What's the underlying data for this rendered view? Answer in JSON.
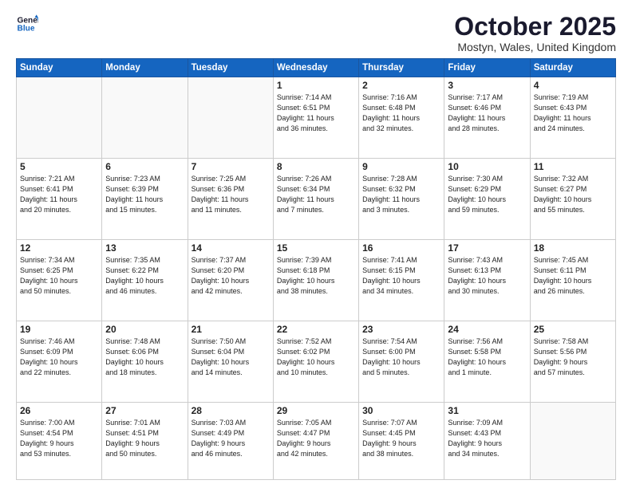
{
  "logo": {
    "line1": "General",
    "line2": "Blue"
  },
  "title": "October 2025",
  "location": "Mostyn, Wales, United Kingdom",
  "days_of_week": [
    "Sunday",
    "Monday",
    "Tuesday",
    "Wednesday",
    "Thursday",
    "Friday",
    "Saturday"
  ],
  "weeks": [
    [
      {
        "day": "",
        "info": ""
      },
      {
        "day": "",
        "info": ""
      },
      {
        "day": "",
        "info": ""
      },
      {
        "day": "1",
        "info": "Sunrise: 7:14 AM\nSunset: 6:51 PM\nDaylight: 11 hours\nand 36 minutes."
      },
      {
        "day": "2",
        "info": "Sunrise: 7:16 AM\nSunset: 6:48 PM\nDaylight: 11 hours\nand 32 minutes."
      },
      {
        "day": "3",
        "info": "Sunrise: 7:17 AM\nSunset: 6:46 PM\nDaylight: 11 hours\nand 28 minutes."
      },
      {
        "day": "4",
        "info": "Sunrise: 7:19 AM\nSunset: 6:43 PM\nDaylight: 11 hours\nand 24 minutes."
      }
    ],
    [
      {
        "day": "5",
        "info": "Sunrise: 7:21 AM\nSunset: 6:41 PM\nDaylight: 11 hours\nand 20 minutes."
      },
      {
        "day": "6",
        "info": "Sunrise: 7:23 AM\nSunset: 6:39 PM\nDaylight: 11 hours\nand 15 minutes."
      },
      {
        "day": "7",
        "info": "Sunrise: 7:25 AM\nSunset: 6:36 PM\nDaylight: 11 hours\nand 11 minutes."
      },
      {
        "day": "8",
        "info": "Sunrise: 7:26 AM\nSunset: 6:34 PM\nDaylight: 11 hours\nand 7 minutes."
      },
      {
        "day": "9",
        "info": "Sunrise: 7:28 AM\nSunset: 6:32 PM\nDaylight: 11 hours\nand 3 minutes."
      },
      {
        "day": "10",
        "info": "Sunrise: 7:30 AM\nSunset: 6:29 PM\nDaylight: 10 hours\nand 59 minutes."
      },
      {
        "day": "11",
        "info": "Sunrise: 7:32 AM\nSunset: 6:27 PM\nDaylight: 10 hours\nand 55 minutes."
      }
    ],
    [
      {
        "day": "12",
        "info": "Sunrise: 7:34 AM\nSunset: 6:25 PM\nDaylight: 10 hours\nand 50 minutes."
      },
      {
        "day": "13",
        "info": "Sunrise: 7:35 AM\nSunset: 6:22 PM\nDaylight: 10 hours\nand 46 minutes."
      },
      {
        "day": "14",
        "info": "Sunrise: 7:37 AM\nSunset: 6:20 PM\nDaylight: 10 hours\nand 42 minutes."
      },
      {
        "day": "15",
        "info": "Sunrise: 7:39 AM\nSunset: 6:18 PM\nDaylight: 10 hours\nand 38 minutes."
      },
      {
        "day": "16",
        "info": "Sunrise: 7:41 AM\nSunset: 6:15 PM\nDaylight: 10 hours\nand 34 minutes."
      },
      {
        "day": "17",
        "info": "Sunrise: 7:43 AM\nSunset: 6:13 PM\nDaylight: 10 hours\nand 30 minutes."
      },
      {
        "day": "18",
        "info": "Sunrise: 7:45 AM\nSunset: 6:11 PM\nDaylight: 10 hours\nand 26 minutes."
      }
    ],
    [
      {
        "day": "19",
        "info": "Sunrise: 7:46 AM\nSunset: 6:09 PM\nDaylight: 10 hours\nand 22 minutes."
      },
      {
        "day": "20",
        "info": "Sunrise: 7:48 AM\nSunset: 6:06 PM\nDaylight: 10 hours\nand 18 minutes."
      },
      {
        "day": "21",
        "info": "Sunrise: 7:50 AM\nSunset: 6:04 PM\nDaylight: 10 hours\nand 14 minutes."
      },
      {
        "day": "22",
        "info": "Sunrise: 7:52 AM\nSunset: 6:02 PM\nDaylight: 10 hours\nand 10 minutes."
      },
      {
        "day": "23",
        "info": "Sunrise: 7:54 AM\nSunset: 6:00 PM\nDaylight: 10 hours\nand 5 minutes."
      },
      {
        "day": "24",
        "info": "Sunrise: 7:56 AM\nSunset: 5:58 PM\nDaylight: 10 hours\nand 1 minute."
      },
      {
        "day": "25",
        "info": "Sunrise: 7:58 AM\nSunset: 5:56 PM\nDaylight: 9 hours\nand 57 minutes."
      }
    ],
    [
      {
        "day": "26",
        "info": "Sunrise: 7:00 AM\nSunset: 4:54 PM\nDaylight: 9 hours\nand 53 minutes."
      },
      {
        "day": "27",
        "info": "Sunrise: 7:01 AM\nSunset: 4:51 PM\nDaylight: 9 hours\nand 50 minutes."
      },
      {
        "day": "28",
        "info": "Sunrise: 7:03 AM\nSunset: 4:49 PM\nDaylight: 9 hours\nand 46 minutes."
      },
      {
        "day": "29",
        "info": "Sunrise: 7:05 AM\nSunset: 4:47 PM\nDaylight: 9 hours\nand 42 minutes."
      },
      {
        "day": "30",
        "info": "Sunrise: 7:07 AM\nSunset: 4:45 PM\nDaylight: 9 hours\nand 38 minutes."
      },
      {
        "day": "31",
        "info": "Sunrise: 7:09 AM\nSunset: 4:43 PM\nDaylight: 9 hours\nand 34 minutes."
      },
      {
        "day": "",
        "info": ""
      }
    ]
  ]
}
